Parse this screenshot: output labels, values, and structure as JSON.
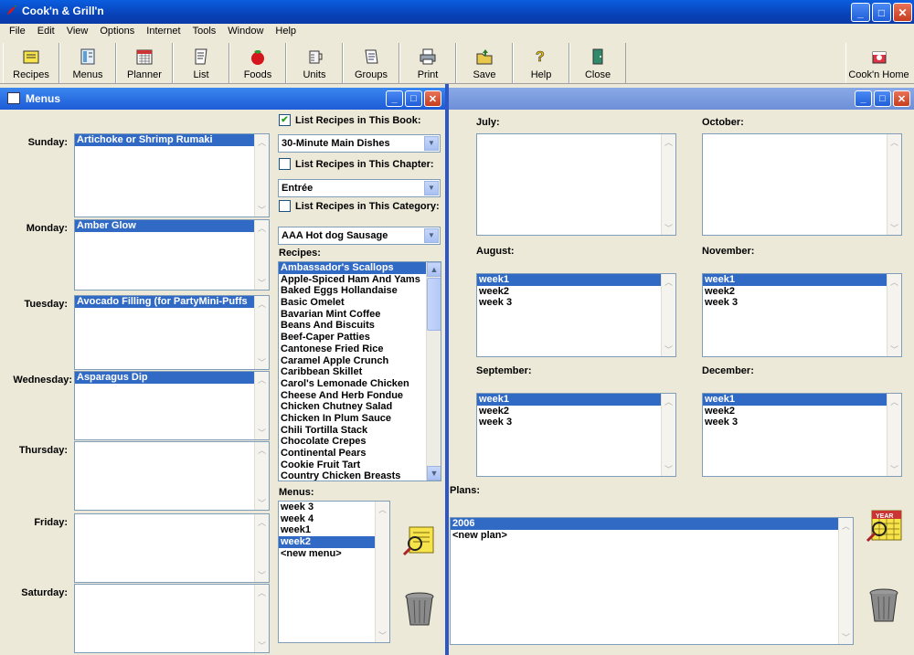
{
  "window": {
    "title": "Cook'n & Grill'n"
  },
  "menubar": [
    "File",
    "Edit",
    "View",
    "Options",
    "Internet",
    "Tools",
    "Window",
    "Help"
  ],
  "toolbar": {
    "buttons": [
      "Recipes",
      "Menus",
      "Planner",
      "List",
      "Foods",
      "Units",
      "Groups",
      "Print",
      "Save",
      "Help",
      "Close"
    ],
    "home": "Cook'n Home"
  },
  "menus_window": {
    "title": "Menus",
    "days": [
      {
        "label": "Sunday:",
        "item": "Artichoke or Shrimp Rumaki"
      },
      {
        "label": "Monday:",
        "item": "Amber Glow"
      },
      {
        "label": "Tuesday:",
        "item": "Avocado Filling (for PartyMini-Puffs"
      },
      {
        "label": "Wednesday:",
        "item": "Asparagus Dip"
      },
      {
        "label": "Thursday:",
        "item": ""
      },
      {
        "label": "Friday:",
        "item": ""
      },
      {
        "label": "Saturday:",
        "item": ""
      }
    ],
    "book_check": {
      "label": "List Recipes in This Book:",
      "checked": true
    },
    "book_value": "30-Minute Main Dishes",
    "chapter_check": {
      "label": "List Recipes in This Chapter:",
      "checked": false
    },
    "chapter_value": "Entrée",
    "category_check": {
      "label": "List Recipes in This Category:",
      "checked": false
    },
    "category_value": "AAA Hot dog Sausage",
    "recipes_label": "Recipes:",
    "recipes": [
      "Ambassador's Scallops",
      "Apple-Spiced Ham And Yams",
      "Baked Eggs Hollandaise",
      "Basic Omelet",
      "Bavarian Mint Coffee",
      "Beans And Biscuits",
      "Beef-Caper Patties",
      "Cantonese Fried Rice",
      "Caramel Apple Crunch",
      "Caribbean Skillet",
      "Carol's Lemonade Chicken",
      "Cheese And Herb Fondue",
      "Chicken Chutney Salad",
      "Chicken In Plum Sauce",
      "Chili Tortilla Stack",
      "Chocolate Crepes",
      "Continental Pears",
      "Cookie Fruit Tart",
      "Country Chicken Breasts"
    ],
    "menus_label": "Menus:",
    "menus": [
      "week 3",
      "week 4",
      "week1",
      "week2",
      "<new menu>"
    ]
  },
  "planner_window": {
    "months": [
      {
        "label": "July:",
        "items": []
      },
      {
        "label": "October:",
        "items": []
      },
      {
        "label": "August:",
        "items": [
          "week1",
          "week2",
          "week 3"
        ]
      },
      {
        "label": "November:",
        "items": [
          "week1",
          "week2",
          "week 3"
        ]
      },
      {
        "label": "September:",
        "items": [
          "week1",
          "week2",
          "week 3"
        ]
      },
      {
        "label": "December:",
        "items": [
          "week1",
          "week2",
          "week 3"
        ]
      }
    ],
    "plans_label": "Plans:",
    "plans": [
      "2006",
      "<new plan>"
    ],
    "year_icon_text": "YEAR"
  },
  "colors": {
    "selection": "#316ac5",
    "titlebar": "#0a5ee0"
  }
}
